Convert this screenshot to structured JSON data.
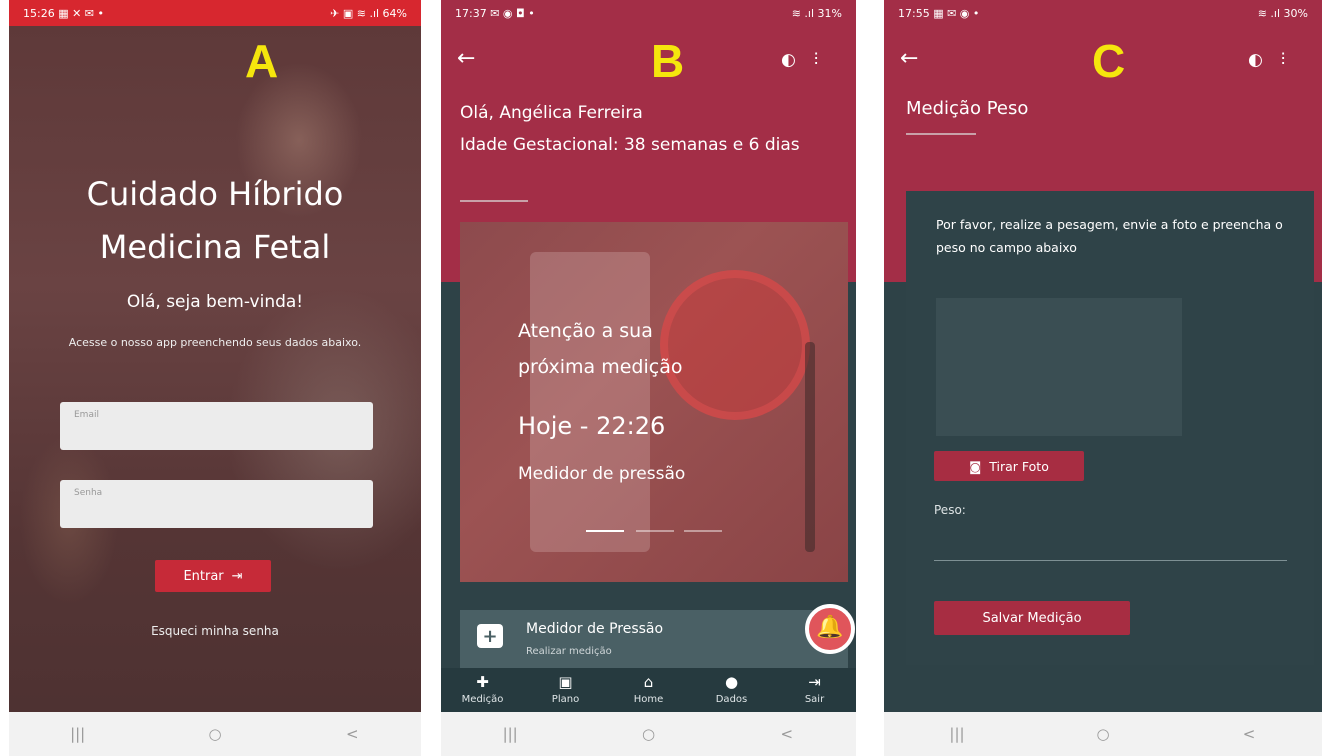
{
  "panels": {
    "a": {
      "letter": "A",
      "status": {
        "time": "15:26",
        "left_icons": "▦ ✕ ✉ •",
        "right_icons": "✈ ▣ ≋ .ıl 64%"
      },
      "title_line1": "Cuidado Híbrido",
      "title_line2": "Medicina Fetal",
      "greeting": "Olá, seja bem-vinda!",
      "description": "Acesse o nosso app preenchendo seus dados abaixo.",
      "email_placeholder": "Email",
      "password_placeholder": "Senha",
      "login_label": "Entrar",
      "login_icon": "⇥",
      "forgot_label": "Esqueci minha senha",
      "nav": {
        "recent": "|||",
        "home": "○",
        "back": "<"
      }
    },
    "b": {
      "letter": "B",
      "status": {
        "time": "17:37",
        "left_icons": "✉ ◉ ◘ •",
        "right_icons": "≋ .ıl 31%"
      },
      "back_icon": "←",
      "contrast_icon": "◐",
      "settings_icon": "⫶",
      "greeting": "Olá, Angélica Ferreira",
      "gestational": "Idade Gestacional: 38 semanas e 6 dias",
      "carousel": {
        "line1": "Atenção a sua",
        "line2": "próxima medição",
        "time": "Hoje - 22:26",
        "device": "Medidor de pressão"
      },
      "card": {
        "title": "Medidor de Pressão",
        "subtitle": "Realizar medição",
        "icon": "+"
      },
      "fab_icon": "🔔",
      "tabs": [
        {
          "icon": "✚",
          "label": "Medição"
        },
        {
          "icon": "▣",
          "label": "Plano"
        },
        {
          "icon": "⌂",
          "label": "Home"
        },
        {
          "icon": "●",
          "label": "Dados"
        },
        {
          "icon": "⇥",
          "label": "Sair"
        }
      ],
      "nav": {
        "recent": "|||",
        "home": "○",
        "back": "<"
      }
    },
    "c": {
      "letter": "C",
      "status": {
        "time": "17:55",
        "left_icons": "▦ ✉ ◉ •",
        "right_icons": "≋ .ıl 30%"
      },
      "back_icon": "←",
      "contrast_icon": "◐",
      "settings_icon": "⫶",
      "title": "Medição Peso",
      "instructions": "Por favor, realize a pesagem, envie a foto e preencha o peso no campo abaixo",
      "photo_button": "Tirar Foto",
      "camera_icon": "◙",
      "weight_label": "Peso:",
      "weight_value": "",
      "save_button": "Salvar Medição",
      "nav": {
        "recent": "|||",
        "home": "○",
        "back": "<"
      }
    }
  },
  "colors": {
    "status_red": "#d7272f",
    "header_red": "#a32e47",
    "dark_teal": "#2e4247",
    "button_red": "#c62a38",
    "letter_yellow": "#f5e60d"
  }
}
